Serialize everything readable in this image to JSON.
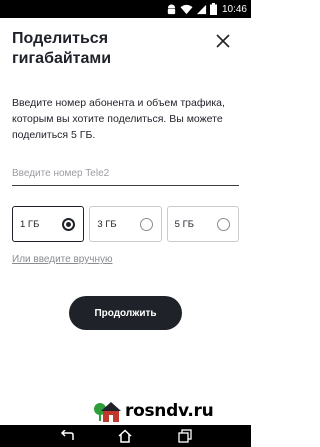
{
  "status_bar": {
    "time": "10:46",
    "icons": [
      "android-icon",
      "wifi-icon",
      "signal-icon",
      "battery-icon"
    ]
  },
  "dialog": {
    "title": "Поделиться гигабайтами",
    "description": "Введите номер абонента и объем трафика, которым вы хотите поделиться. Вы можете поделиться 5 ГБ.",
    "phone_input": {
      "placeholder": "Введите номер Tele2",
      "value": ""
    },
    "options": [
      {
        "label": "1 ГБ",
        "selected": true
      },
      {
        "label": "3 ГБ",
        "selected": false
      },
      {
        "label": "5 ГБ",
        "selected": false
      }
    ],
    "manual_link": "Или введите вручную",
    "continue_button": "Продолжить"
  },
  "watermark": {
    "text": "rosndv.ru"
  },
  "nav_bar": {
    "buttons": [
      "back-icon",
      "home-icon",
      "recent-apps-icon"
    ]
  },
  "colors": {
    "primary": "#1f2229",
    "status_bar": "#000000",
    "placeholder": "#9a9ca2",
    "watermark_green": "#2e9e3a"
  }
}
